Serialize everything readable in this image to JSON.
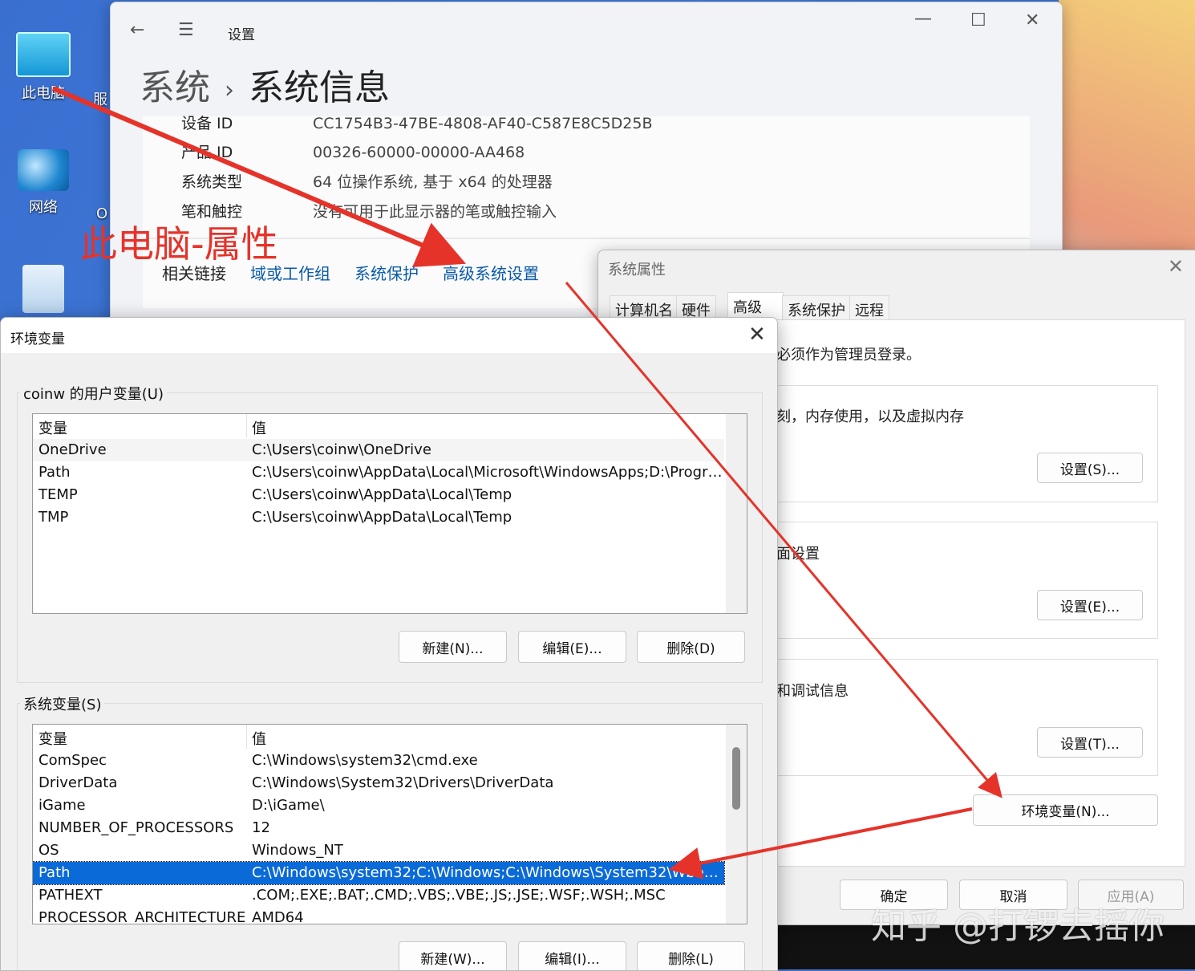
{
  "desktop": {
    "icons": [
      {
        "label": "此电脑"
      },
      {
        "label": "网络"
      },
      {
        "label": ""
      }
    ],
    "peek_text_1": "服",
    "peek_text_2": "O"
  },
  "settings": {
    "title": "设置",
    "breadcrumb_parent": "系统",
    "breadcrumb_sep": "›",
    "breadcrumb_current": "系统信息",
    "rows": [
      {
        "key": "设备 ID",
        "value": "CC1754B3-47BE-4808-AF40-C587E8C5D25B"
      },
      {
        "key": "产品 ID",
        "value": "00326-60000-00000-AA468"
      },
      {
        "key": "系统类型",
        "value": "64 位操作系统, 基于 x64 的处理器"
      },
      {
        "key": "笔和触控",
        "value": "没有可用于此显示器的笔或触控输入"
      }
    ],
    "related_label": "相关链接",
    "links": [
      "域或工作组",
      "系统保护",
      "高级系统设置"
    ],
    "btn_back": "←",
    "btn_menu": "☰",
    "btn_min": "—",
    "btn_max": "☐",
    "btn_close": "✕"
  },
  "annotation": {
    "text": "此电脑-属性",
    "color": "#e5332a"
  },
  "sysprops": {
    "title": "系统属性",
    "close": "✕",
    "tabs": [
      "计算机名",
      "硬件",
      "高级",
      "系统保护",
      "远程"
    ],
    "active_tab": "高级",
    "admin_note": "必须作为管理员登录。",
    "group1_text": "刻，内存使用，以及虚拟内存",
    "group1_button": "设置(S)...",
    "group2_text": "面设置",
    "group2_button": "设置(E)...",
    "group3_text": "和调试信息",
    "group3_button": "设置(T)...",
    "env_button": "环境变量(N)...",
    "ok": "确定",
    "cancel": "取消",
    "apply": "应用(A)"
  },
  "envvars": {
    "title": "环境变量",
    "close": "✕",
    "user_section": "coinw 的用户变量(U)",
    "columns": [
      "变量",
      "值"
    ],
    "user_vars": [
      {
        "name": "OneDrive",
        "value": "C:\\Users\\coinw\\OneDrive"
      },
      {
        "name": "Path",
        "value": "C:\\Users\\coinw\\AppData\\Local\\Microsoft\\WindowsApps;D:\\Progra..."
      },
      {
        "name": "TEMP",
        "value": "C:\\Users\\coinw\\AppData\\Local\\Temp"
      },
      {
        "name": "TMP",
        "value": "C:\\Users\\coinw\\AppData\\Local\\Temp"
      }
    ],
    "user_buttons": [
      "新建(N)...",
      "编辑(E)...",
      "删除(D)"
    ],
    "system_section": "系统变量(S)",
    "system_vars": [
      {
        "name": "ComSpec",
        "value": "C:\\Windows\\system32\\cmd.exe"
      },
      {
        "name": "DriverData",
        "value": "C:\\Windows\\System32\\Drivers\\DriverData"
      },
      {
        "name": "iGame",
        "value": "D:\\iGame\\"
      },
      {
        "name": "NUMBER_OF_PROCESSORS",
        "value": "12"
      },
      {
        "name": "OS",
        "value": "Windows_NT"
      },
      {
        "name": "Path",
        "value": "C:\\Windows\\system32;C:\\Windows;C:\\Windows\\System32\\Wbem;..."
      },
      {
        "name": "PATHEXT",
        "value": ".COM;.EXE;.BAT;.CMD;.VBS;.VBE;.JS;.JSE;.WSF;.WSH;.MSC"
      },
      {
        "name": "PROCESSOR_ARCHITECTURE",
        "value": "AMD64"
      }
    ],
    "selected_system_var": "Path",
    "system_buttons": [
      "新建(W)...",
      "编辑(I)...",
      "删除(L)"
    ]
  },
  "watermark": "知乎 @打锣去摇你"
}
